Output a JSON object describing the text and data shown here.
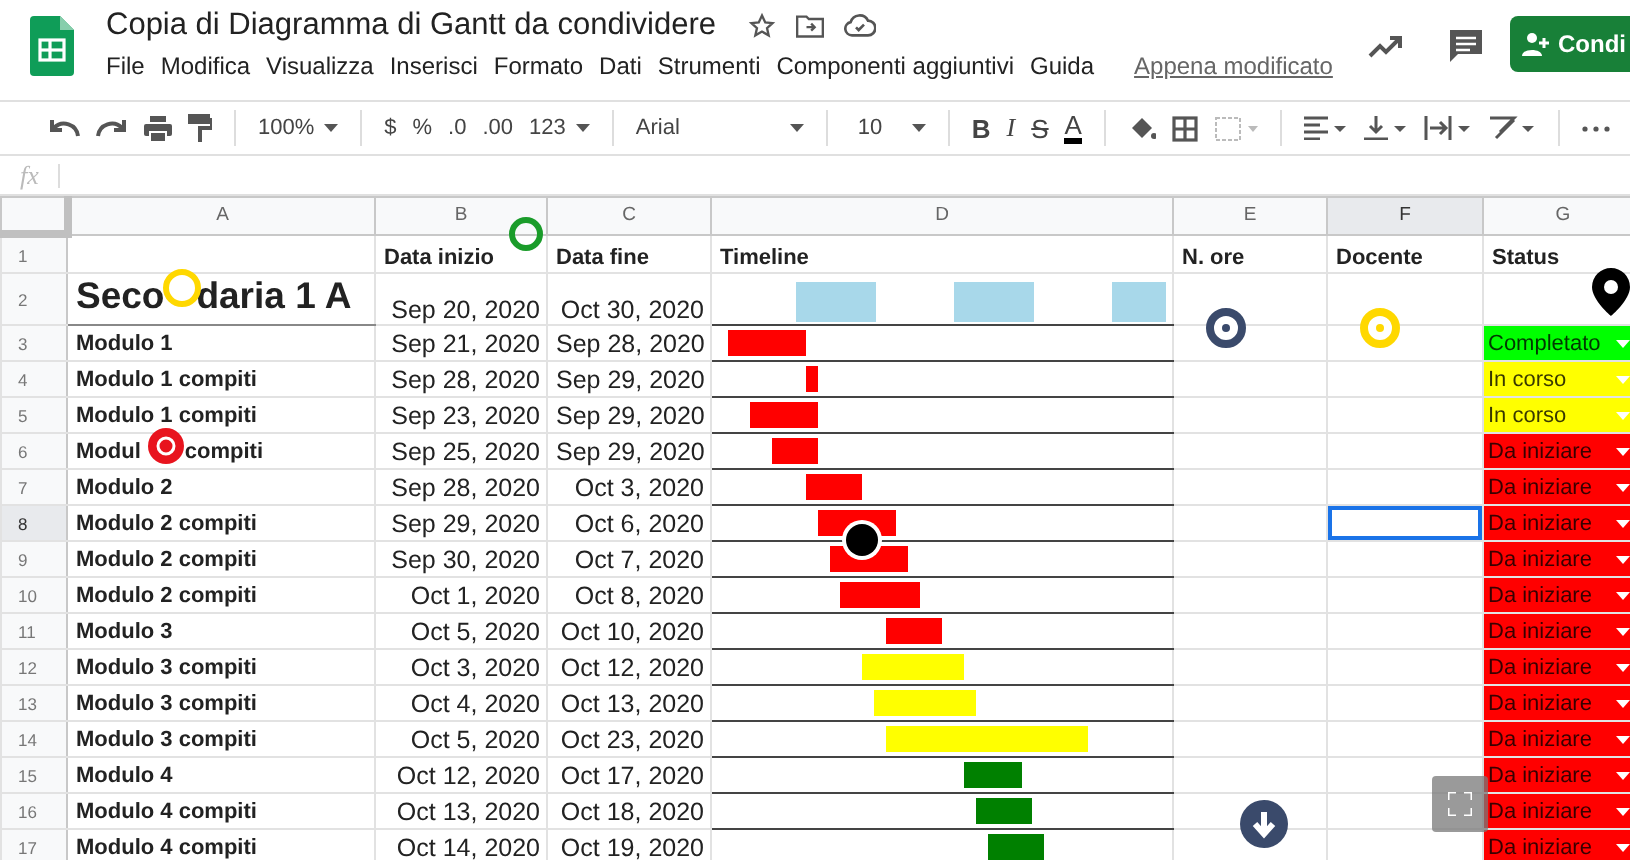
{
  "app": {
    "title": "Copia di Diagramma di Gantt da condividere",
    "menu": [
      "File",
      "Modifica",
      "Visualizza",
      "Inserisci",
      "Formato",
      "Dati",
      "Strumenti",
      "Componenti aggiuntivi",
      "Guida"
    ],
    "last_edit": "Appena modificato",
    "share_button": "Condi"
  },
  "toolbar": {
    "zoom": "100%",
    "currency": "$",
    "percent": "%",
    "decrease_decimals": ".0",
    "increase_decimals": ".00",
    "number_format": "123",
    "font": "Arial",
    "font_size": "10",
    "bold": "B",
    "italic": "I",
    "strike": "S",
    "text_color": "A"
  },
  "formula_bar": {
    "label": "fx"
  },
  "columns": [
    {
      "label": "A",
      "selected": false
    },
    {
      "label": "B",
      "selected": false
    },
    {
      "label": "C",
      "selected": false
    },
    {
      "label": "D",
      "selected": false
    },
    {
      "label": "E",
      "selected": false
    },
    {
      "label": "F",
      "selected": true
    },
    {
      "label": "G",
      "selected": false
    }
  ],
  "header_row": {
    "number": "1",
    "start": "Data inizio",
    "end": "Data fine",
    "timeline": "Timeline",
    "hours": "N. ore",
    "teacher": "Docente",
    "status": "Status"
  },
  "title_row": {
    "number": "2",
    "title": [
      "Seco",
      "daria 1 A"
    ],
    "start": "Sep 20, 2020",
    "end": "Oct 30, 2020"
  },
  "tasks": [
    {
      "number": "3",
      "name": [
        "Modulo 1"
      ],
      "start": "Sep 21, 2020",
      "end": "Sep 28, 2020",
      "timeline": {
        "color": "#ff0000"
      },
      "status": {
        "label": "Completato",
        "color": "#00ff00"
      },
      "selected": false
    },
    {
      "number": "4",
      "name": [
        "Modulo 1 compiti"
      ],
      "start": "Sep 28, 2020",
      "end": "Sep 29, 2020",
      "timeline": {
        "color": "#ff0000"
      },
      "status": {
        "label": "In corso",
        "color": "#ffff00"
      },
      "selected": false
    },
    {
      "number": "5",
      "name": [
        "Modulo 1 compiti"
      ],
      "start": "Sep 23, 2020",
      "end": "Sep 29, 2020",
      "timeline": {
        "color": "#ff0000"
      },
      "status": {
        "label": "In corso",
        "color": "#ffff00"
      },
      "selected": false
    },
    {
      "number": "6",
      "name": [
        "Modul",
        "compiti"
      ],
      "start": "Sep 25, 2020",
      "end": "Sep 29, 2020",
      "timeline": {
        "color": "#ff0000"
      },
      "status": {
        "label": "Da iniziare",
        "color": "#ff0000"
      },
      "selected": false
    },
    {
      "number": "7",
      "name": [
        "Modulo 2"
      ],
      "start": "Sep 28, 2020",
      "end": "Oct 3, 2020",
      "timeline": {
        "color": "#ff0000"
      },
      "status": {
        "label": "Da iniziare",
        "color": "#ff0000"
      },
      "selected": false
    },
    {
      "number": "8",
      "name": [
        "Modulo 2 compiti"
      ],
      "start": "Sep 29, 2020",
      "end": "Oct 6, 2020",
      "timeline": {
        "color": "#ff0000"
      },
      "status": {
        "label": "Da iniziare",
        "color": "#ff0000"
      },
      "selected": true
    },
    {
      "number": "9",
      "name": [
        "Modulo 2 compiti"
      ],
      "start": "Sep 30, 2020",
      "end": "Oct 7, 2020",
      "timeline": {
        "color": "#ff0000"
      },
      "status": {
        "label": "Da iniziare",
        "color": "#ff0000"
      },
      "selected": false
    },
    {
      "number": "10",
      "name": [
        "Modulo 2 compiti"
      ],
      "start": "Oct 1, 2020",
      "end": "Oct 8, 2020",
      "timeline": {
        "color": "#ff0000"
      },
      "status": {
        "label": "Da iniziare",
        "color": "#ff0000"
      },
      "selected": false
    },
    {
      "number": "11",
      "name": [
        "Modulo 3"
      ],
      "start": "Oct 5, 2020",
      "end": "Oct 10, 2020",
      "timeline": {
        "color": "#ff0000"
      },
      "status": {
        "label": "Da iniziare",
        "color": "#ff0000"
      },
      "selected": false
    },
    {
      "number": "12",
      "name": [
        "Modulo 3 compiti"
      ],
      "start": "Oct 3, 2020",
      "end": "Oct 12, 2020",
      "timeline": {
        "color": "#ffff00"
      },
      "status": {
        "label": "Da iniziare",
        "color": "#ff0000"
      },
      "selected": false
    },
    {
      "number": "13",
      "name": [
        "Modulo 3 compiti"
      ],
      "start": "Oct 4, 2020",
      "end": "Oct 13, 2020",
      "timeline": {
        "color": "#ffff00"
      },
      "status": {
        "label": "Da iniziare",
        "color": "#ff0000"
      },
      "selected": false
    },
    {
      "number": "14",
      "name": [
        "Modulo 3 compiti"
      ],
      "start": "Oct 5, 2020",
      "end": "Oct 23, 2020",
      "timeline": {
        "color": "#ffff00"
      },
      "status": {
        "label": "Da iniziare",
        "color": "#ff0000"
      },
      "selected": false
    },
    {
      "number": "15",
      "name": [
        "Modulo 4"
      ],
      "start": "Oct 12, 2020",
      "end": "Oct 17, 2020",
      "timeline": {
        "color": "#008000"
      },
      "status": {
        "label": "Da iniziare",
        "color": "#ff0000"
      },
      "selected": false
    },
    {
      "number": "16",
      "name": [
        "Modulo 4 compiti"
      ],
      "start": "Oct 13, 2020",
      "end": "Oct 18, 2020",
      "timeline": {
        "color": "#008000"
      },
      "status": {
        "label": "Da iniziare",
        "color": "#ff0000"
      },
      "selected": false
    },
    {
      "number": "17",
      "name": [
        "Modulo 4 compiti"
      ],
      "start": "Oct 14, 2020",
      "end": "Oct 19, 2020",
      "timeline": {
        "color": "#008000"
      },
      "status": {
        "label": "Da iniziare",
        "color": "#ff0000"
      },
      "selected": false
    }
  ]
}
